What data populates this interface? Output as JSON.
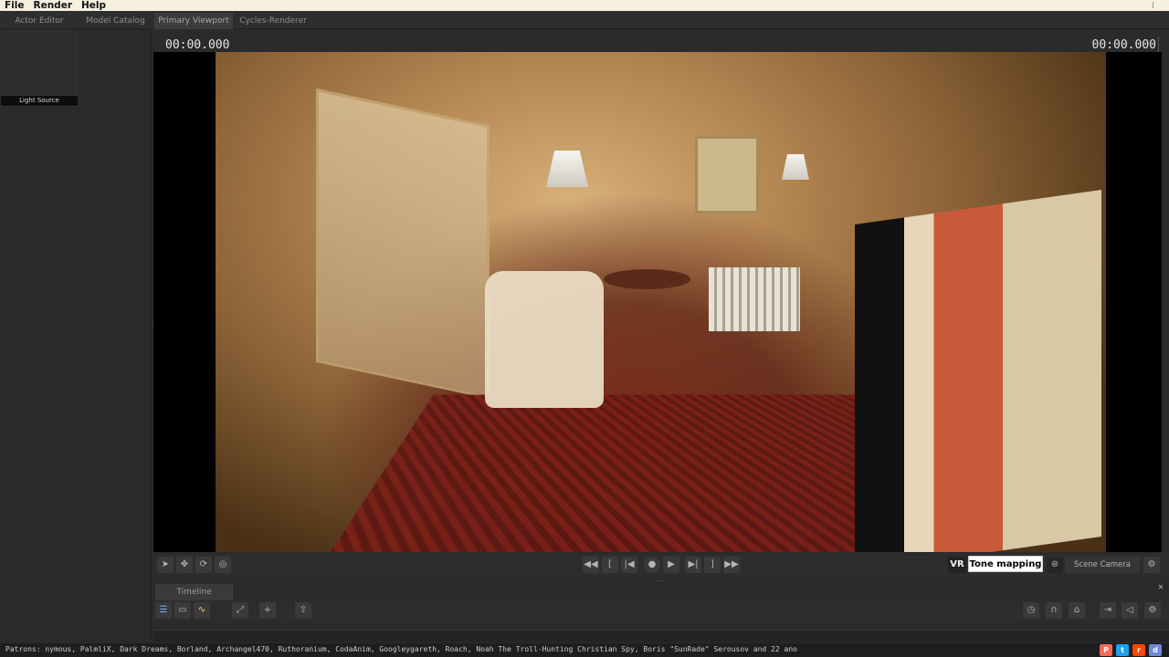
{
  "menu": {
    "items": [
      "File",
      "Render",
      "Help"
    ]
  },
  "tabs": [
    {
      "label": "Actor Editor",
      "active": false
    },
    {
      "label": "Model Catalog",
      "active": false
    },
    {
      "label": "Primary Viewport",
      "active": true
    },
    {
      "label": "Cycles-Renderer",
      "active": false
    }
  ],
  "left_panel": {
    "thumbnail_label": "Light Source"
  },
  "viewport": {
    "timecode_left": "00:00.000",
    "timecode_right": "00:00.000"
  },
  "toolbar": {
    "vr_label": "VR",
    "tone_mapping_label": "Tone mapping",
    "camera_label": "Scene Camera"
  },
  "timeline": {
    "tab_label": "Timeline"
  },
  "status": {
    "patrons": "Patrons: nymous, PalmliX, Dark Dreams, Borland, Archangel470, Ruthoranium, CodaAnim, Googleygareth, Roach, Noah The Troll-Hunting Christian Spy, Boris \"SunRade\" Serousov and 22 ano"
  },
  "colors": {
    "menubar_bg": "#f5f1de",
    "panel_bg": "#2b2b2b",
    "patreon": "#f96854",
    "twitter": "#1da1f2",
    "reddit": "#ff4500",
    "discord": "#7289da"
  }
}
